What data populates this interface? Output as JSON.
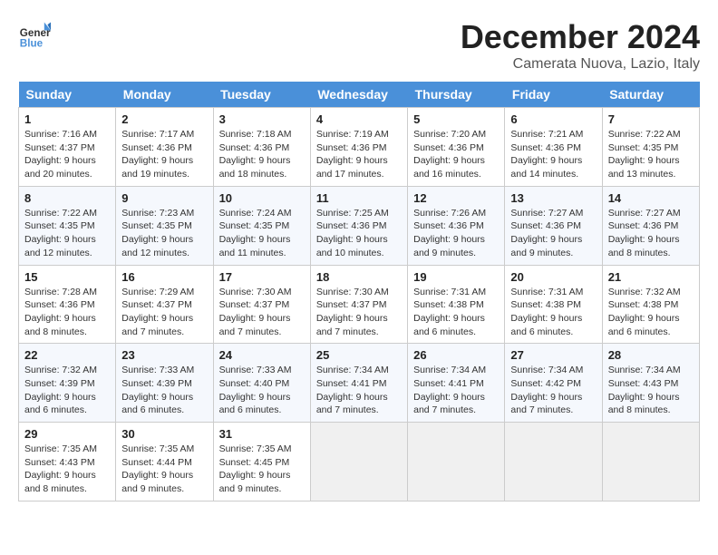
{
  "header": {
    "logo": {
      "general": "General",
      "blue": "Blue"
    },
    "title": "December 2024",
    "location": "Camerata Nuova, Lazio, Italy"
  },
  "weekdays": [
    "Sunday",
    "Monday",
    "Tuesday",
    "Wednesday",
    "Thursday",
    "Friday",
    "Saturday"
  ],
  "weeks": [
    [
      {
        "day": "1",
        "sunrise": "7:16 AM",
        "sunset": "4:37 PM",
        "daylight": "9 hours and 20 minutes"
      },
      {
        "day": "2",
        "sunrise": "7:17 AM",
        "sunset": "4:36 PM",
        "daylight": "9 hours and 19 minutes"
      },
      {
        "day": "3",
        "sunrise": "7:18 AM",
        "sunset": "4:36 PM",
        "daylight": "9 hours and 18 minutes"
      },
      {
        "day": "4",
        "sunrise": "7:19 AM",
        "sunset": "4:36 PM",
        "daylight": "9 hours and 17 minutes"
      },
      {
        "day": "5",
        "sunrise": "7:20 AM",
        "sunset": "4:36 PM",
        "daylight": "9 hours and 16 minutes"
      },
      {
        "day": "6",
        "sunrise": "7:21 AM",
        "sunset": "4:36 PM",
        "daylight": "9 hours and 14 minutes"
      },
      {
        "day": "7",
        "sunrise": "7:22 AM",
        "sunset": "4:35 PM",
        "daylight": "9 hours and 13 minutes"
      }
    ],
    [
      {
        "day": "8",
        "sunrise": "7:22 AM",
        "sunset": "4:35 PM",
        "daylight": "9 hours and 12 minutes"
      },
      {
        "day": "9",
        "sunrise": "7:23 AM",
        "sunset": "4:35 PM",
        "daylight": "9 hours and 12 minutes"
      },
      {
        "day": "10",
        "sunrise": "7:24 AM",
        "sunset": "4:35 PM",
        "daylight": "9 hours and 11 minutes"
      },
      {
        "day": "11",
        "sunrise": "7:25 AM",
        "sunset": "4:36 PM",
        "daylight": "9 hours and 10 minutes"
      },
      {
        "day": "12",
        "sunrise": "7:26 AM",
        "sunset": "4:36 PM",
        "daylight": "9 hours and 9 minutes"
      },
      {
        "day": "13",
        "sunrise": "7:27 AM",
        "sunset": "4:36 PM",
        "daylight": "9 hours and 9 minutes"
      },
      {
        "day": "14",
        "sunrise": "7:27 AM",
        "sunset": "4:36 PM",
        "daylight": "9 hours and 8 minutes"
      }
    ],
    [
      {
        "day": "15",
        "sunrise": "7:28 AM",
        "sunset": "4:36 PM",
        "daylight": "9 hours and 8 minutes"
      },
      {
        "day": "16",
        "sunrise": "7:29 AM",
        "sunset": "4:37 PM",
        "daylight": "9 hours and 7 minutes"
      },
      {
        "day": "17",
        "sunrise": "7:30 AM",
        "sunset": "4:37 PM",
        "daylight": "9 hours and 7 minutes"
      },
      {
        "day": "18",
        "sunrise": "7:30 AM",
        "sunset": "4:37 PM",
        "daylight": "9 hours and 7 minutes"
      },
      {
        "day": "19",
        "sunrise": "7:31 AM",
        "sunset": "4:38 PM",
        "daylight": "9 hours and 6 minutes"
      },
      {
        "day": "20",
        "sunrise": "7:31 AM",
        "sunset": "4:38 PM",
        "daylight": "9 hours and 6 minutes"
      },
      {
        "day": "21",
        "sunrise": "7:32 AM",
        "sunset": "4:38 PM",
        "daylight": "9 hours and 6 minutes"
      }
    ],
    [
      {
        "day": "22",
        "sunrise": "7:32 AM",
        "sunset": "4:39 PM",
        "daylight": "9 hours and 6 minutes"
      },
      {
        "day": "23",
        "sunrise": "7:33 AM",
        "sunset": "4:39 PM",
        "daylight": "9 hours and 6 minutes"
      },
      {
        "day": "24",
        "sunrise": "7:33 AM",
        "sunset": "4:40 PM",
        "daylight": "9 hours and 6 minutes"
      },
      {
        "day": "25",
        "sunrise": "7:34 AM",
        "sunset": "4:41 PM",
        "daylight": "9 hours and 7 minutes"
      },
      {
        "day": "26",
        "sunrise": "7:34 AM",
        "sunset": "4:41 PM",
        "daylight": "9 hours and 7 minutes"
      },
      {
        "day": "27",
        "sunrise": "7:34 AM",
        "sunset": "4:42 PM",
        "daylight": "9 hours and 7 minutes"
      },
      {
        "day": "28",
        "sunrise": "7:34 AM",
        "sunset": "4:43 PM",
        "daylight": "9 hours and 8 minutes"
      }
    ],
    [
      {
        "day": "29",
        "sunrise": "7:35 AM",
        "sunset": "4:43 PM",
        "daylight": "9 hours and 8 minutes"
      },
      {
        "day": "30",
        "sunrise": "7:35 AM",
        "sunset": "4:44 PM",
        "daylight": "9 hours and 9 minutes"
      },
      {
        "day": "31",
        "sunrise": "7:35 AM",
        "sunset": "4:45 PM",
        "daylight": "9 hours and 9 minutes"
      },
      null,
      null,
      null,
      null
    ]
  ]
}
